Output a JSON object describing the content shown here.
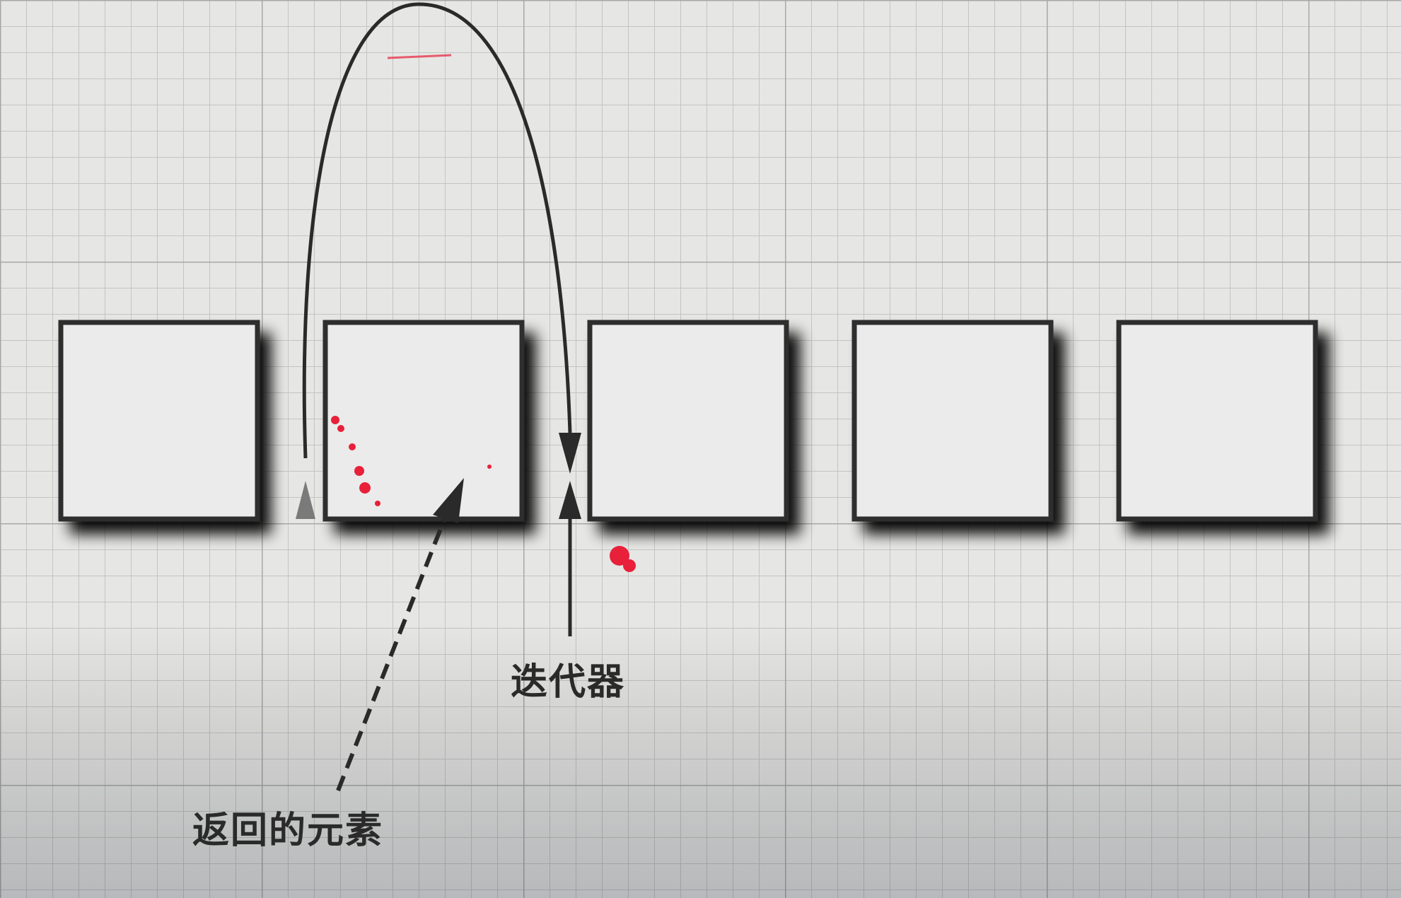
{
  "diagram": {
    "element_count": 5,
    "returned_element_index": 2,
    "iterator_gap_index": 2,
    "labels": {
      "iterator": "迭代器",
      "returned_element": "返回的元素"
    },
    "colors": {
      "paper": "#e6e6e4",
      "grid_line": "#bdbdbd",
      "box_fill": "#ebebeb",
      "box_border": "#2e2e2e",
      "arrow": "#2a2a2a",
      "annotation_red": "#e8203a"
    }
  }
}
